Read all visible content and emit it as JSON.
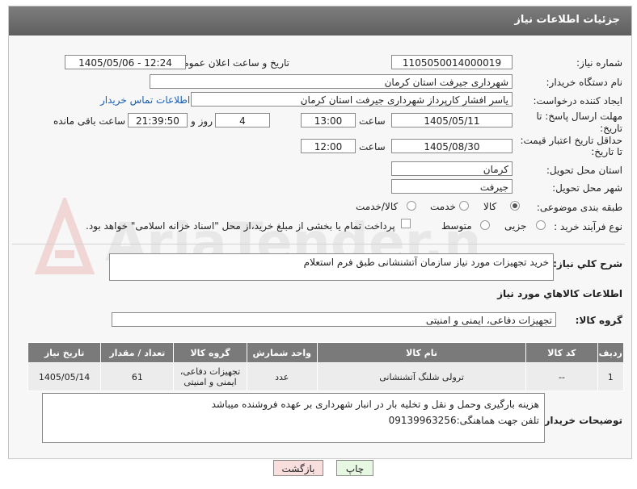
{
  "window": {
    "title": "جزئیات اطلاعات نیاز"
  },
  "form": {
    "need_number": {
      "label": "شماره نیاز:",
      "value": "1105050014000019"
    },
    "announce_datetime": {
      "label": "تاریخ و ساعت اعلان عمومی:",
      "value": "1405/05/06 - 12:24"
    },
    "buyer_org": {
      "label": "نام دستگاه خریدار:",
      "value": "شهرداری جیرفت استان کرمان"
    },
    "requester": {
      "label": "ایجاد کننده درخواست:",
      "value": "یاسر افشار کارپرداز شهرداری جیرفت استان کرمان",
      "contact_link": "اطلاعات تماس خریدار"
    },
    "deadline": {
      "label_line1": "مهلت ارسال پاسخ: تا",
      "label_line2": "تاریخ:",
      "date": "1405/05/11",
      "time_label": "ساعت",
      "time": "13:00",
      "days": "4",
      "days_label": "روز و",
      "remaining": "21:39:50",
      "remaining_label": "ساعت باقی مانده"
    },
    "price_validity": {
      "label_line1": "حداقل تاریخ اعتبار قیمت:",
      "label_line2": "تا تاریخ:",
      "date": "1405/08/30",
      "time_label": "ساعت",
      "time": "12:00"
    },
    "province": {
      "label": "استان محل تحویل:",
      "value": "کرمان"
    },
    "city": {
      "label": "شهر محل تحویل:",
      "value": "جیرفت"
    },
    "category": {
      "label": "طبقه بندی موضوعی:",
      "options": [
        "کالا",
        "خدمت",
        "کالا/خدمت"
      ],
      "selected": "کالا"
    },
    "process": {
      "label": "نوع فرآیند خرید :",
      "options": [
        "جزیی",
        "متوسط"
      ],
      "selected": "",
      "treasury_text": "پرداخت تمام یا بخشی از مبلغ خرید،از محل \"اسناد خزانه اسلامی\" خواهد بود."
    }
  },
  "description": {
    "label": "شرح کلي نياز:",
    "value": "خرید تجهیزات مورد نیاز سازمان آتشنشانی طبق فرم استعلام"
  },
  "goods_section": {
    "title": "اطلاعات کالاهاي مورد نياز",
    "group_label": "گروه کالا:",
    "group_value": "تجهیزات دفاعی، ایمنی و امنیتی"
  },
  "table": {
    "columns": [
      "ردیف",
      "کد کالا",
      "نام کالا",
      "واحد شمارش",
      "گروه کالا",
      "تعداد / مقدار",
      "تاریخ نیاز"
    ],
    "rows": [
      {
        "row": "1",
        "code": "--",
        "name": "ترولی شلنگ آتشنشانی",
        "unit": "عدد",
        "group": "تجهیزات دفاعی، ایمنی و امنیتی",
        "qty": "61",
        "date": "1405/05/14"
      }
    ]
  },
  "buyer_notes": {
    "label": "توضیحات خریدار:",
    "line1": "هزینه بارگیری وحمل و نقل و تخلیه بار در انبار شهرداری بر عهده فروشنده میباشد",
    "line2": "تلفن جهت هماهنگی:09139963256"
  },
  "buttons": {
    "print": "چاپ",
    "back": "بازگشت"
  },
  "watermark": "AriaTender.net"
}
